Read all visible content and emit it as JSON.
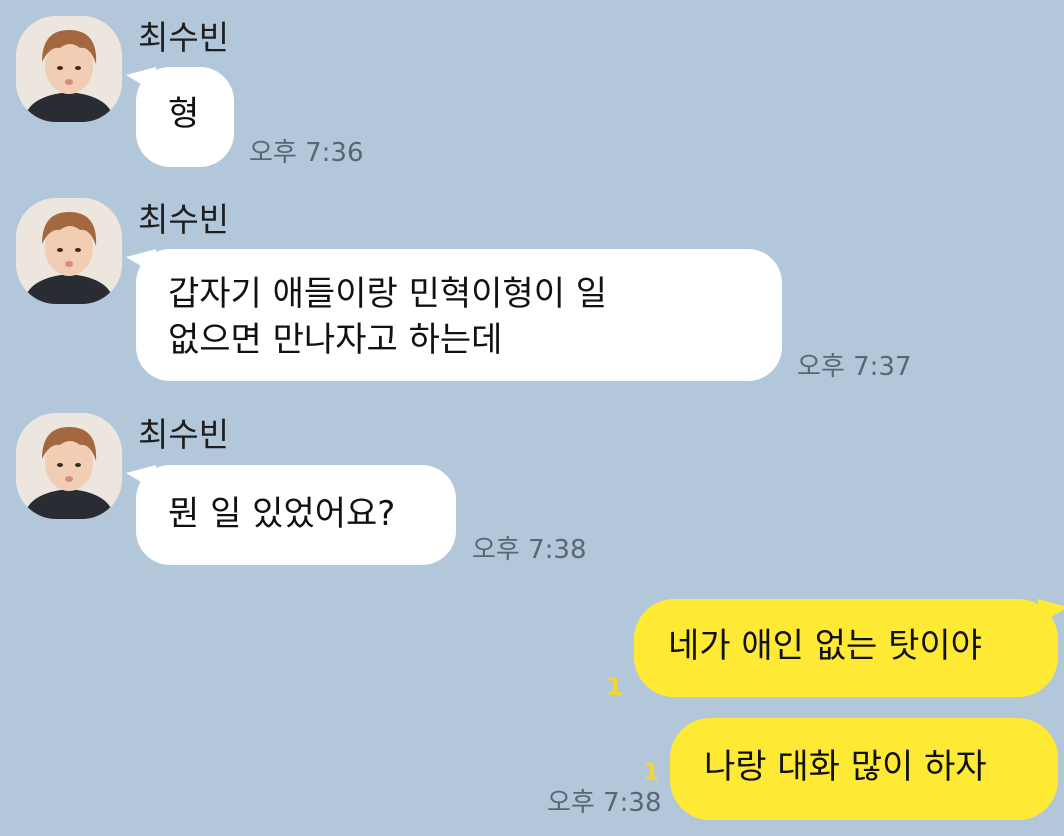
{
  "sender_name": "최수빈",
  "messages": [
    {
      "direction": "in",
      "lines": [
        "형"
      ],
      "time": "오후 7:36"
    },
    {
      "direction": "in",
      "lines": [
        "갑자기 애들이랑 민혁이형이 일",
        "없으면 만나자고 하는데"
      ],
      "time": "오후 7:37"
    },
    {
      "direction": "in",
      "lines": [
        "뭔 일 있었어요?"
      ],
      "time": "오후 7:38"
    },
    {
      "direction": "out",
      "lines": [
        "네가 애인 없는 탓이야"
      ],
      "unread": "1"
    },
    {
      "direction": "out",
      "lines": [
        "나랑 대화 많이 하자"
      ],
      "unread": "1",
      "time": "오후 7:38"
    }
  ],
  "colors": {
    "background": "#b2c7da",
    "incoming_bubble": "#ffffff",
    "outgoing_bubble": "#fee934",
    "unread_count": "#f3d436"
  },
  "icons": {
    "avatar": "profile-photo"
  }
}
